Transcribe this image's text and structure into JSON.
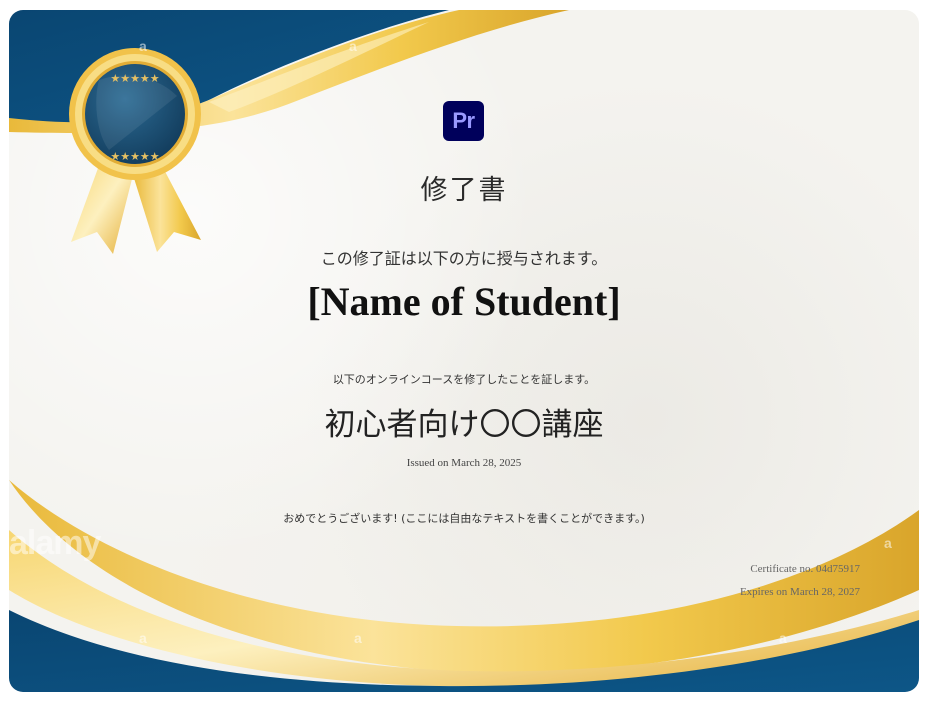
{
  "certificate": {
    "logo_text": "Pr",
    "title": "修了書",
    "granted_text": "この修了証は以下の方に授与されます。",
    "student_name": "[Name of Student]",
    "certify_text": "以下のオンラインコースを修了したことを証します。",
    "course_name": "初心者向け〇〇講座",
    "issued_text": "Issued on March 28, 2025",
    "message_text": "おめでとうございます! (ここには自由なテキストを書くことができます。)",
    "certificate_no": "Certificate no. 04d75917",
    "expires_text": "Expires on March 28, 2027"
  },
  "watermarks": {
    "brand": "alamy",
    "mark": "a"
  },
  "colors": {
    "navy": "#0b4a76",
    "gold": "#f2c94c",
    "gold_light": "#fbe7a1",
    "paper": "#f4f3ef",
    "logo_bg": "#00005b",
    "logo_text": "#9999ff"
  }
}
